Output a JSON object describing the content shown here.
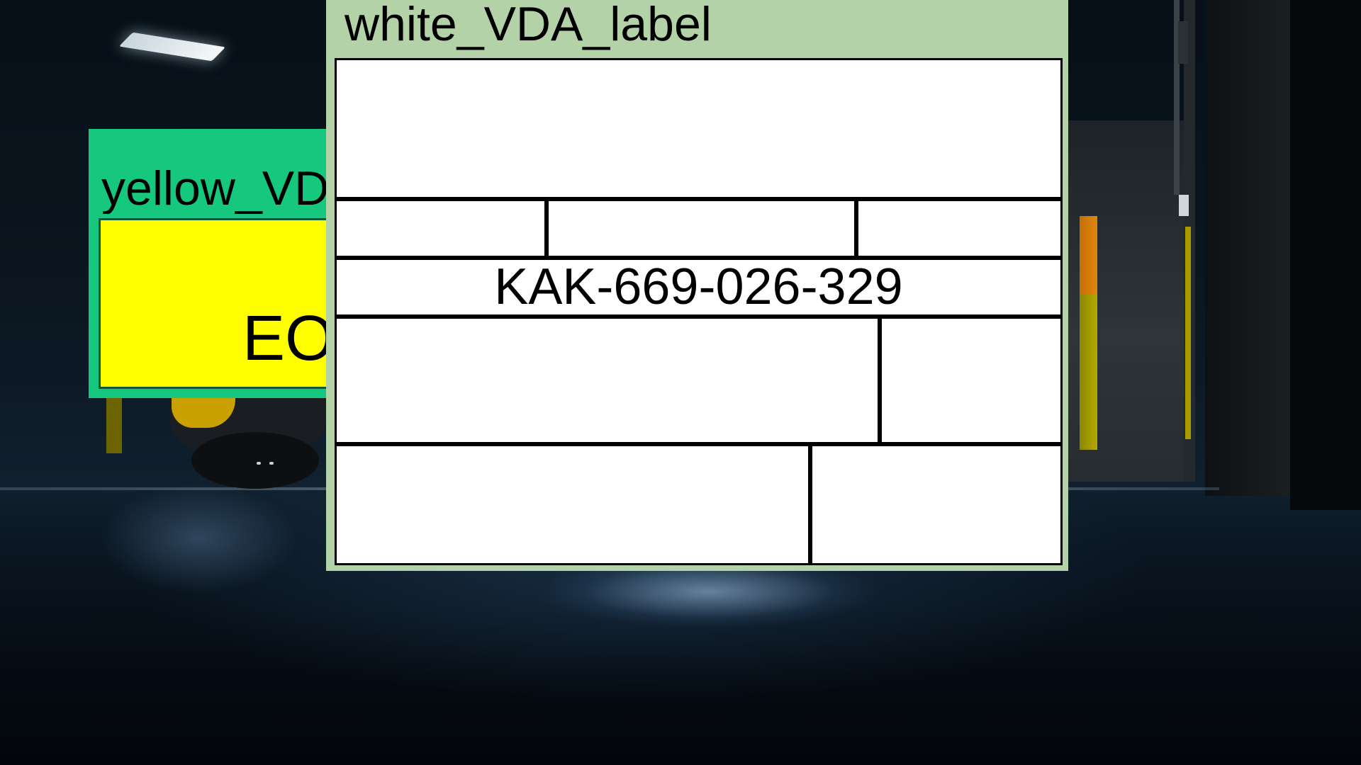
{
  "labels": {
    "yellow": {
      "header": "yellow_VDA_label",
      "body_text": "EO",
      "frame_color": "#16c87e",
      "fill_color": "#ffff00"
    },
    "white": {
      "header": "white_VDA_label",
      "code": "KAK-669-026-329",
      "frame_color": "#b3d2a7",
      "fill_color": "#ffffff"
    }
  }
}
